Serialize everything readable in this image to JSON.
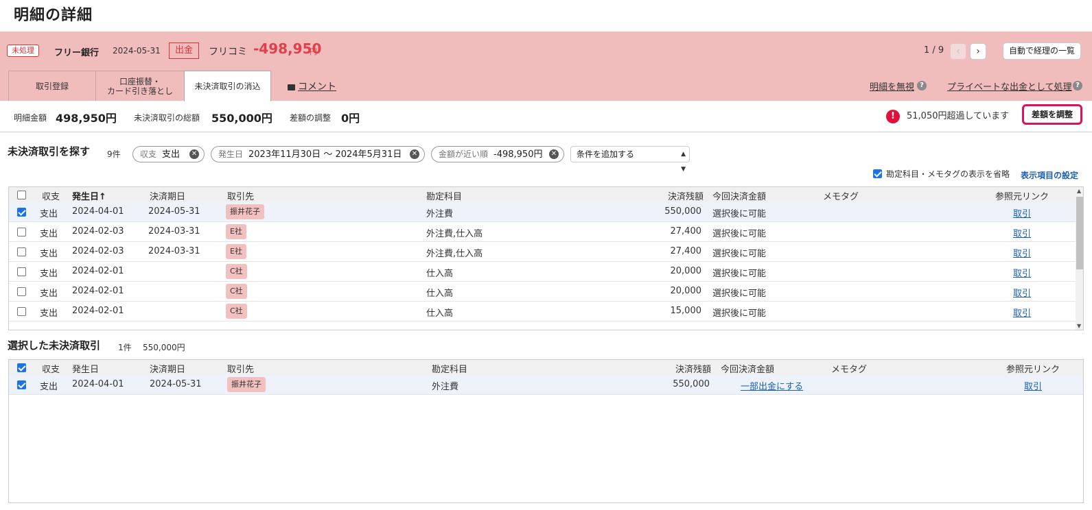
{
  "page": {
    "title": "明細の詳細"
  },
  "statement": {
    "status": "未処理",
    "bank": "フリー銀行",
    "date": "2024-05-31",
    "direction": "出金",
    "description": "フリコミ",
    "amount": "-498,950",
    "unit": "円",
    "pager": "1 / 9",
    "prev_icon": "chevron-left-icon",
    "next_icon": "chevron-right-icon",
    "auto_list_label": "自動で経理の一覧"
  },
  "tabs": [
    {
      "label": "取引登録"
    },
    {
      "label_line1": "口座振替・",
      "label_line2": "カード引き落とし"
    },
    {
      "label": "未決済取引の消込"
    }
  ],
  "links": {
    "comment": "コメント",
    "ignore": "明細を無視",
    "private": "プライベートな出金として処理"
  },
  "summary": {
    "stmt_amount_label": "明細金額",
    "stmt_amount": "498,950円",
    "total_label": "未決済取引の総額",
    "total": "550,000円",
    "diff_label": "差額の調整",
    "diff": "0円",
    "alert_text": "51,050円超過しています",
    "adjust_button": "差額を調整"
  },
  "search": {
    "title": "未決済取引を探す",
    "count": "9件",
    "chips": [
      {
        "label": "収支",
        "value": "支出"
      },
      {
        "label": "発生日",
        "value": "2023年11月30日 〜 2024年5月31日"
      },
      {
        "label": "金額が近い順",
        "value": "-498,950円"
      }
    ],
    "add_condition": "条件を追加する",
    "memo_toggle": "勘定科目・メモタグの表示を省略",
    "display_settings": "表示項目の設定"
  },
  "columns": {
    "type": "収支",
    "date": "発生日",
    "sort_arrow": "↑",
    "due": "決済期日",
    "partner": "取引先",
    "account": "勘定科目",
    "balance": "決済残額",
    "this_amount": "今回決済金額",
    "memo": "メモタグ",
    "ref": "参照元リンク"
  },
  "unsettled_rows": [
    {
      "checked": true,
      "type": "支出",
      "date": "2024-04-01",
      "due": "2024-05-31",
      "partner": "振井花子",
      "account": "外注費",
      "balance": "550,000",
      "this_amount": "選択後に可能",
      "ref": "取引"
    },
    {
      "checked": false,
      "type": "支出",
      "date": "2024-02-03",
      "due": "2024-03-31",
      "partner": "E社",
      "account": "外注費,仕入高",
      "balance": "27,400",
      "this_amount": "選択後に可能",
      "ref": "取引"
    },
    {
      "checked": false,
      "type": "支出",
      "date": "2024-02-03",
      "due": "2024-03-31",
      "partner": "E社",
      "account": "外注費,仕入高",
      "balance": "27,400",
      "this_amount": "選択後に可能",
      "ref": "取引"
    },
    {
      "checked": false,
      "type": "支出",
      "date": "2024-02-01",
      "due": "",
      "partner": "C社",
      "account": "仕入高",
      "balance": "20,000",
      "this_amount": "選択後に可能",
      "ref": "取引"
    },
    {
      "checked": false,
      "type": "支出",
      "date": "2024-02-01",
      "due": "",
      "partner": "C社",
      "account": "仕入高",
      "balance": "20,000",
      "this_amount": "選択後に可能",
      "ref": "取引"
    },
    {
      "checked": false,
      "type": "支出",
      "date": "2024-02-01",
      "due": "",
      "partner": "C社",
      "account": "仕入高",
      "balance": "15,000",
      "this_amount": "選択後に可能",
      "ref": "取引"
    }
  ],
  "selected": {
    "title": "選択した未決済取引",
    "count": "1件",
    "total": "550,000円",
    "rows": [
      {
        "checked": true,
        "type": "支出",
        "date": "2024-04-01",
        "due": "2024-05-31",
        "partner": "振井花子",
        "account": "外注費",
        "balance": "550,000",
        "this_amount": "一部出金にする",
        "ref": "取引"
      }
    ]
  }
}
